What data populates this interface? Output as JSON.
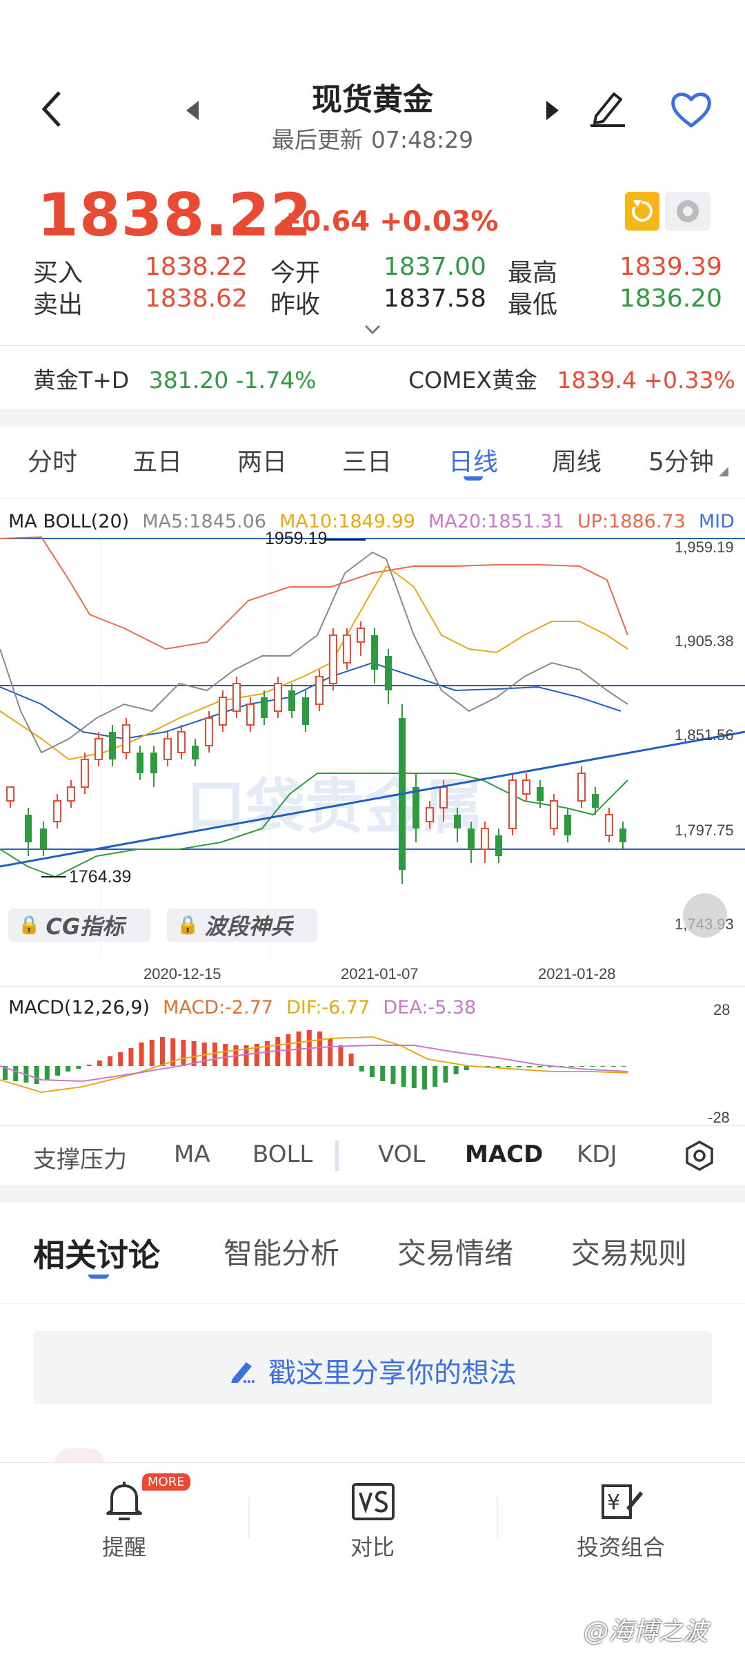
{
  "header": {
    "title": "现货黄金",
    "update_label": "最后更新",
    "update_time": "07:48:29"
  },
  "quote": {
    "price": "1838.22",
    "change": "+0.64",
    "change_pct": "+0.03%",
    "rows": [
      [
        {
          "label": "买入",
          "value": "1838.22",
          "color": "red"
        },
        {
          "label": "今开",
          "value": "1837.00",
          "color": "green"
        },
        {
          "label": "最高",
          "value": "1839.39",
          "color": "red"
        }
      ],
      [
        {
          "label": "卖出",
          "value": "1838.62",
          "color": "red"
        },
        {
          "label": "昨收",
          "value": "1837.58",
          "color": "black"
        },
        {
          "label": "最低",
          "value": "1836.20",
          "color": "green"
        }
      ]
    ]
  },
  "related": [
    {
      "name": "黄金T+D",
      "value": "381.20 -1.74%",
      "color": "green"
    },
    {
      "name": "COMEX黄金",
      "value": "1839.4 +0.33%",
      "color": "red"
    }
  ],
  "period_tabs": [
    "分时",
    "五日",
    "两日",
    "三日",
    "日线",
    "周线",
    "5分钟"
  ],
  "active_period": "日线",
  "main_legend": {
    "name": "MA BOLL(20)",
    "ma5": "MA5:1845.06",
    "ma10": "MA10:1849.99",
    "ma20": "MA20:1851.31",
    "up": "UP:1886.73",
    "mid": "MID"
  },
  "annotations": {
    "high": "1959.19",
    "low": "1764.39"
  },
  "y_ticks": [
    "1,959.19",
    "1,905.38",
    "1,851.56",
    "1,797.75",
    "1,743.93"
  ],
  "x_ticks": [
    "2020-12-15",
    "2021-01-07",
    "2021-01-28"
  ],
  "watermark": "口袋贵金属",
  "locked_indicators": [
    "CG指标",
    "波段神兵"
  ],
  "macd_legend": {
    "name": "MACD(12,26,9)",
    "macd": "MACD:-2.77",
    "dif": "DIF:-6.77",
    "dea": "DEA:-5.38",
    "max": "28",
    "min": "-28"
  },
  "indicator_tabs": [
    "支撑压力",
    "MA",
    "BOLL",
    "VOL",
    "MACD",
    "KDJ"
  ],
  "active_indicator": "MACD",
  "discussion_tabs": [
    "相关讨论",
    "智能分析",
    "交易情绪",
    "交易规则"
  ],
  "share_prompt": "戳这里分享你的想法",
  "bottom_bar": [
    {
      "label": "提醒",
      "icon": "bell-icon",
      "badge": "MORE"
    },
    {
      "label": "对比",
      "icon": "versus-icon"
    },
    {
      "label": "投资组合",
      "icon": "portfolio-icon"
    }
  ],
  "footer_watermark": "@海博之波",
  "colors": {
    "red": "#e84a33",
    "green": "#2f9a3f",
    "blue": "#3e6fe0",
    "ma5": "#888888",
    "ma10": "#e6a817",
    "ma20": "#c879c9",
    "up": "#e86a4a",
    "trend": "#1f5fbf"
  }
}
